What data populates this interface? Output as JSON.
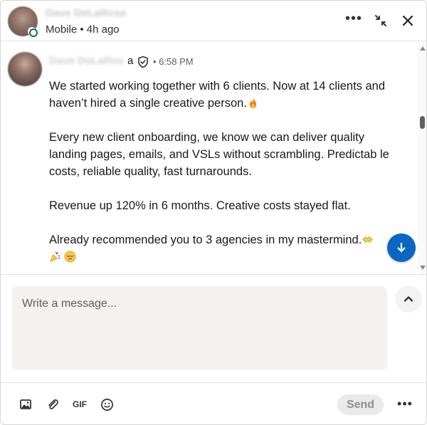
{
  "header": {
    "contact_name": "Dave DeLaRosa",
    "status_text": "Mobile • 4h ago",
    "more_glyph": "•••"
  },
  "message": {
    "sender_name": "Dave DeLaRos",
    "sender_name_tail": "a",
    "time": "• 6:58 PM",
    "paragraphs": [
      "We started working together with 6 clients. Now at 14 clients and haven’t hired a single creative person.",
      "Every new client onboarding, we know we can deliver quality landing pages, emails, and VSLs without scrambling. Predictab le costs, reliable quality, fast turnarounds.",
      "Revenue up 120% in 6 months. Creative costs stayed flat.",
      "Already recommended you to 3 agencies in my mastermind."
    ],
    "emojis": [
      "fire-emoji",
      "handshake-emoji",
      "celebration-emoji",
      "relieved-face-emoji"
    ]
  },
  "compose": {
    "placeholder": "Write a message...",
    "gif_label": "GIF",
    "send_label": "Send",
    "more_glyph": "•••"
  },
  "colors": {
    "accent": "#0a66c2",
    "presence": "#057642",
    "compose_bg": "#f4f2ee"
  }
}
